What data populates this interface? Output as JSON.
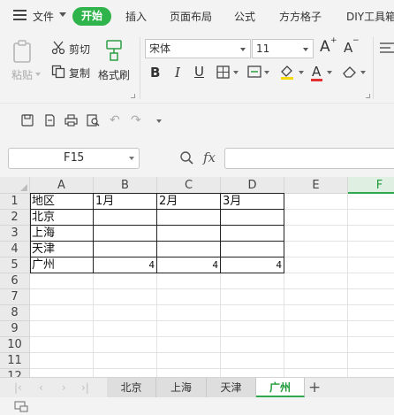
{
  "menu": {
    "file": "文件",
    "items": [
      "开始",
      "插入",
      "页面布局",
      "公式",
      "方方格子",
      "DIY工具箱"
    ]
  },
  "ribbon": {
    "paste": "粘贴",
    "cut": "剪切",
    "copy": "复制",
    "format_painter": "格式刷",
    "font_name": "宋体",
    "font_size": "11",
    "bold": "B",
    "italic": "I",
    "underline": "U",
    "font_color_letter": "A",
    "grow_font": "A",
    "shrink_font": "A"
  },
  "formula_bar": {
    "name_box": "F15",
    "fx": "fx",
    "value": ""
  },
  "grid": {
    "columns": [
      "A",
      "B",
      "C",
      "D",
      "E",
      "F"
    ],
    "selected_column": "F",
    "rows": [
      "1",
      "2",
      "3",
      "4",
      "5",
      "6",
      "7",
      "8",
      "9",
      "10",
      "11",
      "12"
    ],
    "cells": [
      [
        "地区",
        "1月",
        "2月",
        "3月",
        "",
        ""
      ],
      [
        "北京",
        "",
        "",
        "",
        "",
        ""
      ],
      [
        "上海",
        "",
        "",
        "",
        "",
        ""
      ],
      [
        "天津",
        "",
        "",
        "",
        "",
        ""
      ],
      [
        "广州",
        "4",
        "4",
        "4",
        "",
        ""
      ]
    ]
  },
  "sheets": {
    "tabs": [
      "北京",
      "上海",
      "天津",
      "广州"
    ],
    "active": "广州",
    "add": "+"
  },
  "colors": {
    "accent": "#2fb34b",
    "selection": "#2fa84f"
  }
}
